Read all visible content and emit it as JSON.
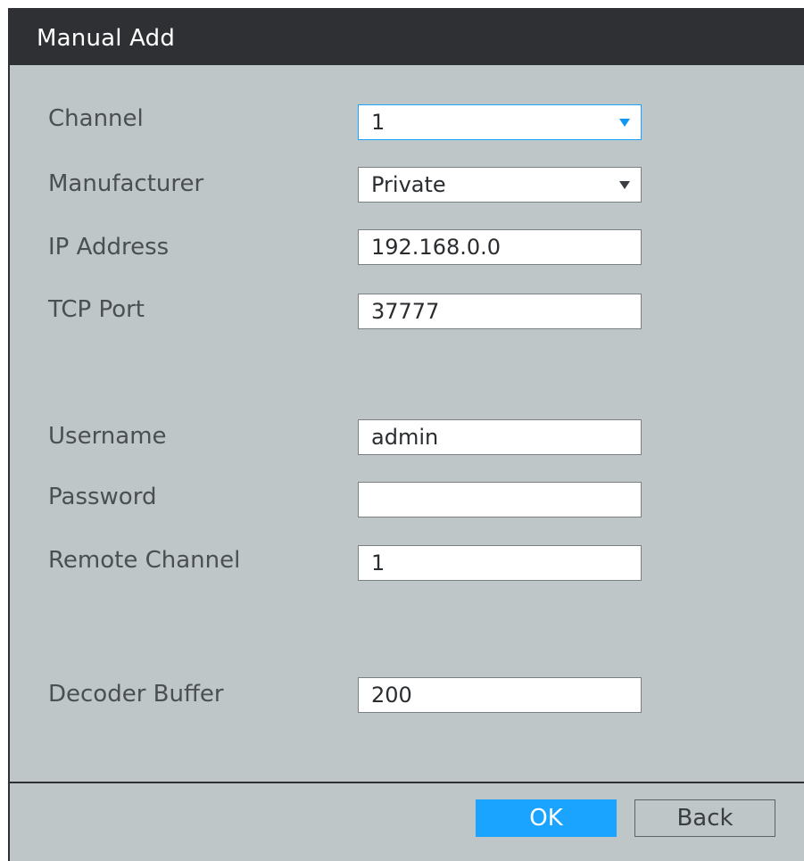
{
  "dialog": {
    "title": "Manual Add"
  },
  "form": {
    "channel": {
      "label": "Channel",
      "value": "1"
    },
    "manufacturer": {
      "label": "Manufacturer",
      "value": "Private"
    },
    "ip_address": {
      "label": "IP Address",
      "value": "192.168.0.0"
    },
    "tcp_port": {
      "label": "TCP Port",
      "value": "37777"
    },
    "username": {
      "label": "Username",
      "value": "admin"
    },
    "password": {
      "label": "Password",
      "value": ""
    },
    "remote_channel": {
      "label": "Remote Channel",
      "value": "1"
    },
    "decoder_buffer": {
      "label": "Decoder Buffer",
      "value": "200"
    }
  },
  "buttons": {
    "ok": "OK",
    "back": "Back"
  },
  "icons": {
    "dropdown": "chevron-down-icon"
  },
  "colors": {
    "title_bar": "#2e3033",
    "panel_bg": "#bfc6c7",
    "accent": "#1aa3ff"
  }
}
